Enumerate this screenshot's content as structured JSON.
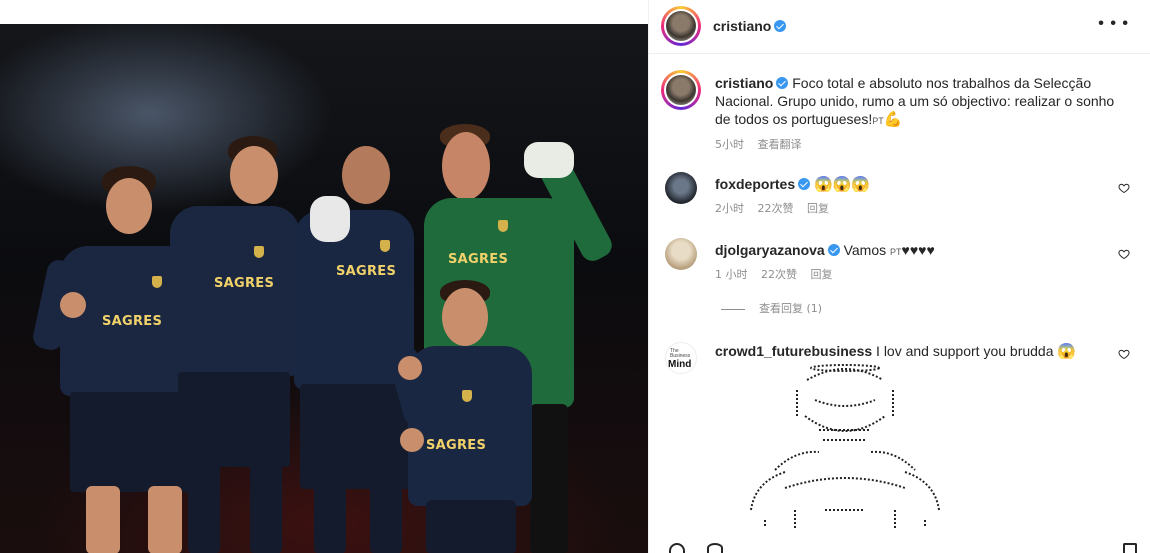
{
  "post": {
    "author": {
      "username": "cristiano",
      "verified": true
    },
    "menu_icon": "more-horizontal-icon",
    "photo": {
      "sponsor_labels": [
        "SAGRES",
        "SAGRES",
        "SAGRES",
        "SAGRES",
        "SAGRES"
      ]
    },
    "caption": {
      "username": "cristiano",
      "text": "Foco total e absoluto nos trabalhos da Selecção Nacional. Grupo unido, rumo a um só objectivo: realizar o sonho de todos os portugueses!",
      "flag": "PT",
      "emoji": "💪",
      "time": "5小时",
      "translate_label": "查看翻译"
    },
    "comments": [
      {
        "username": "foxdeportes",
        "verified": true,
        "text": "",
        "emoji": "😱😱😱",
        "time": "2小时",
        "likes": "22次赞",
        "reply_label": "回复"
      },
      {
        "username": "djolgaryazanova",
        "verified": true,
        "text": "Vamos",
        "flag": "PT",
        "emoji": "♥♥♥♥",
        "time": "1 小时",
        "likes": "22次赞",
        "reply_label": "回复",
        "view_replies": "查看回复 (1)"
      },
      {
        "username": "crowd1_futurebusiness",
        "verified": false,
        "text": "I lov and support you brudda",
        "emoji": "😱",
        "avatar_text_small": "The",
        "avatar_text_mid": "Business",
        "avatar_text_big": "Mind"
      }
    ]
  },
  "colors": {
    "text": "#262626",
    "muted": "#8e8e8e",
    "verified": "#3897f0",
    "jersey_dark": "#1b2740",
    "jersey_green": "#1f6b3c",
    "sponsor": "#f1d26a"
  }
}
